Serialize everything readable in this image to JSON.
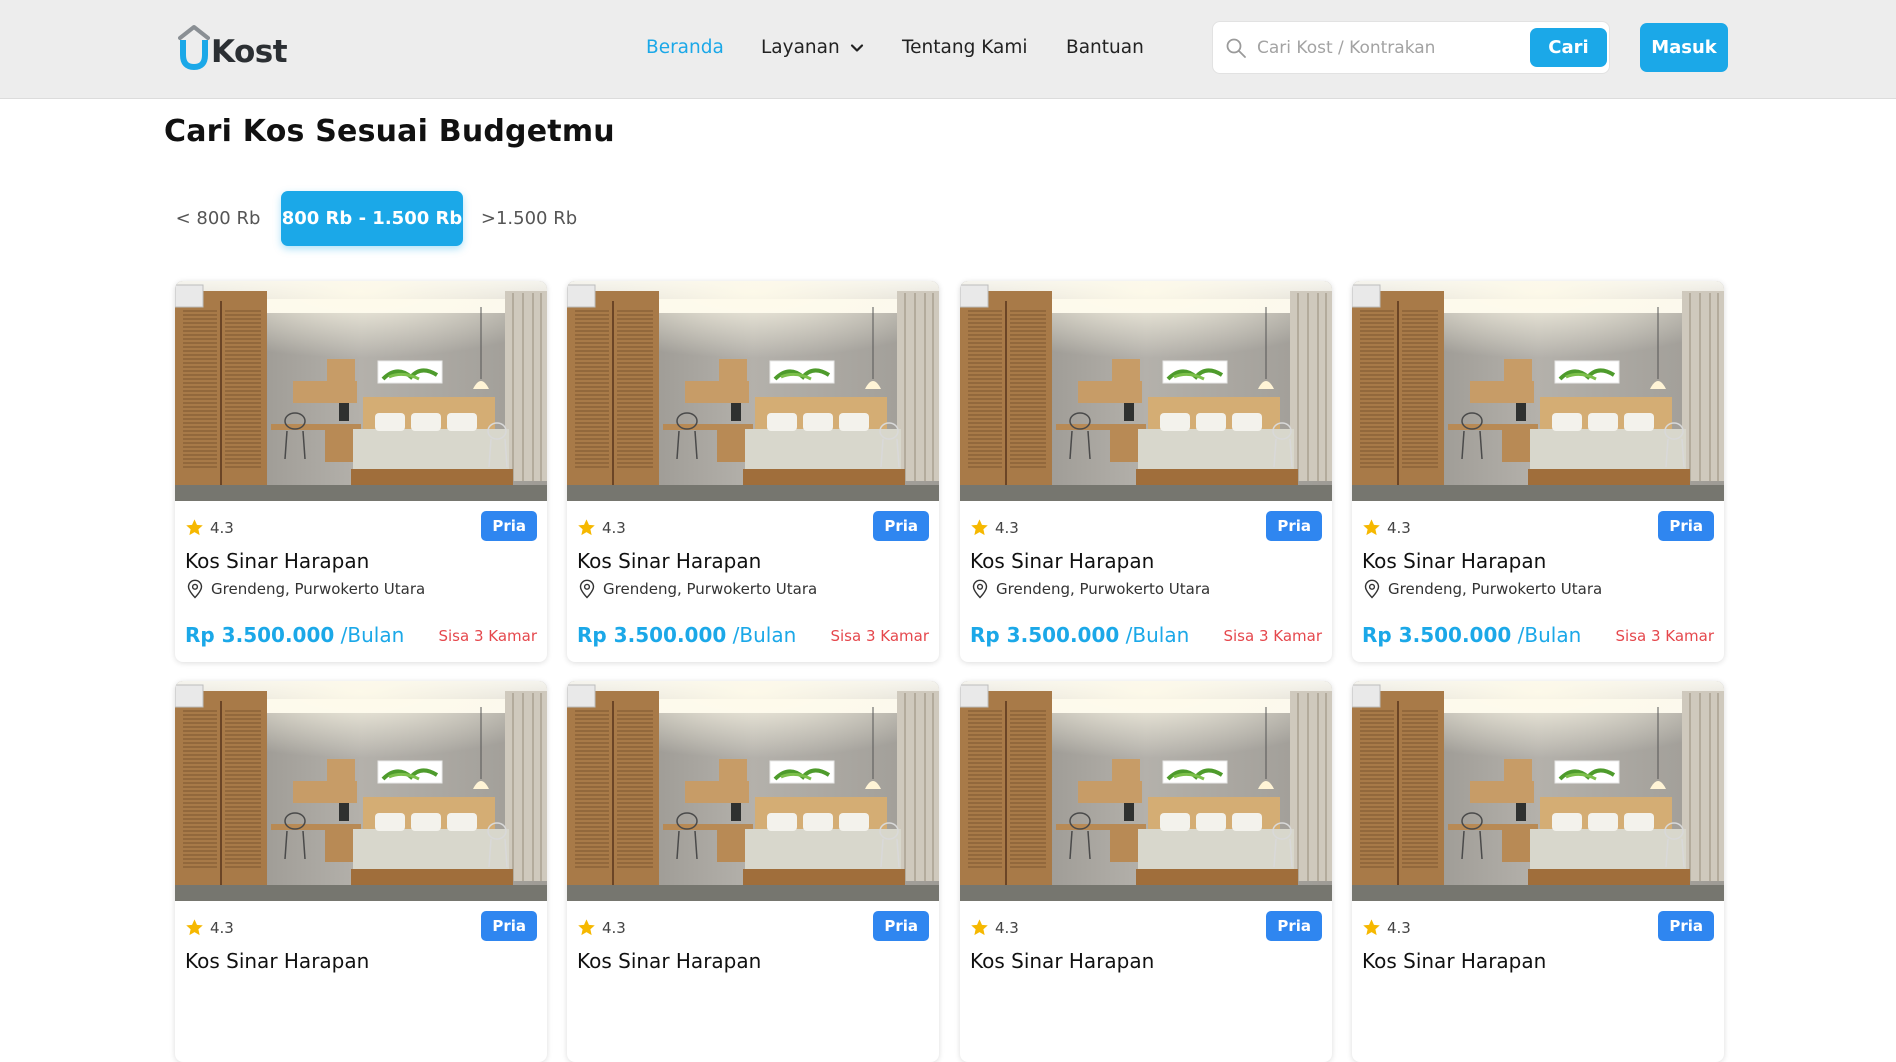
{
  "header": {
    "logo_text": "Kost",
    "nav": [
      {
        "label": "Beranda",
        "active": true
      },
      {
        "label": "Layanan",
        "has_dropdown": true
      },
      {
        "label": "Tentang Kami"
      },
      {
        "label": "Bantuan"
      }
    ],
    "search": {
      "placeholder": "Cari Kost / Kontrakan",
      "button_label": "Cari"
    },
    "login_label": "Masuk"
  },
  "section": {
    "title": "Cari Kos Sesuai Budgetmu",
    "filters": [
      {
        "label": "< 800 Rb",
        "active": false
      },
      {
        "label": "800 Rb - 1.500 Rb",
        "active": true
      },
      {
        "label": ">1.500 Rb",
        "active": false
      }
    ]
  },
  "listings": [
    {
      "rating": "4.3",
      "badge": "Pria",
      "name": "Kos Sinar Harapan",
      "location": "Grendeng, Purwokerto Utara",
      "price": "Rp 3.500.000",
      "unit": " /Bulan",
      "remaining": "Sisa 3 Kamar"
    },
    {
      "rating": "4.3",
      "badge": "Pria",
      "name": "Kos Sinar Harapan",
      "location": "Grendeng, Purwokerto Utara",
      "price": "Rp 3.500.000",
      "unit": " /Bulan",
      "remaining": "Sisa 3 Kamar"
    },
    {
      "rating": "4.3",
      "badge": "Pria",
      "name": "Kos Sinar Harapan",
      "location": "Grendeng, Purwokerto Utara",
      "price": "Rp 3.500.000",
      "unit": " /Bulan",
      "remaining": "Sisa 3 Kamar"
    },
    {
      "rating": "4.3",
      "badge": "Pria",
      "name": "Kos Sinar Harapan",
      "location": "Grendeng, Purwokerto Utara",
      "price": "Rp 3.500.000",
      "unit": " /Bulan",
      "remaining": "Sisa 3 Kamar"
    },
    {
      "rating": "4.3",
      "badge": "Pria",
      "name": "Kos Sinar Harapan"
    },
    {
      "rating": "4.3",
      "badge": "Pria",
      "name": "Kos Sinar Harapan"
    },
    {
      "rating": "4.3",
      "badge": "Pria",
      "name": "Kos Sinar Harapan"
    },
    {
      "rating": "4.3",
      "badge": "Pria",
      "name": "Kos Sinar Harapan"
    }
  ],
  "icons": {
    "logo": "house-roof-u-logo-icon",
    "search": "search-icon",
    "dropdown": "chevron-down-icon",
    "rating": "star-icon",
    "location": "map-pin-icon"
  },
  "colors": {
    "accent": "#1ba8e8",
    "badge": "#2f86f0",
    "star": "#f6b800",
    "remaining": "#e5484d",
    "header_bg": "#ededed"
  }
}
